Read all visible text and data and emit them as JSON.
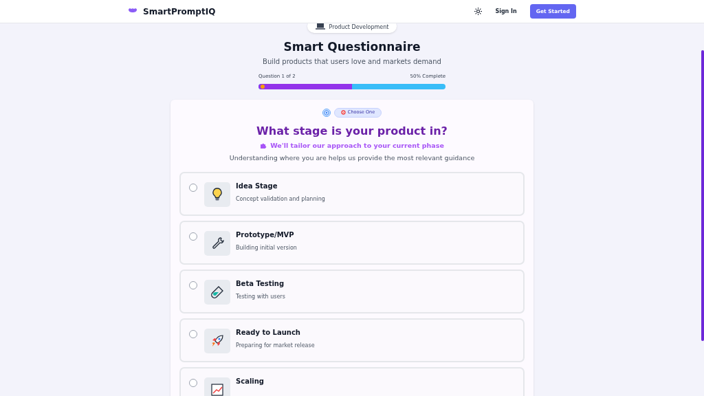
{
  "nav": {
    "brand": "SmartPromptIQ",
    "sign_in": "Sign In",
    "get_started": "Get Started"
  },
  "category": "Product Development",
  "title": "Smart Questionnaire",
  "subtitle": "Build products that users love and markets demand",
  "progress": {
    "label": "Question 1 of 2",
    "reading": "50% Complete",
    "level": 0.5
  },
  "question": {
    "badge": "Choose One",
    "text": "What stage is your product in?",
    "hint": "We'll tailor our approach to your current phase",
    "description": "Understanding where you are helps us provide the most relevant guidance",
    "options": [
      {
        "kind": "bulb",
        "title": "Idea Stage",
        "description": "Concept validation and planning",
        "selected": false
      },
      {
        "kind": "wrench",
        "title": "Prototype/MVP",
        "description": "Building initial version",
        "selected": false
      },
      {
        "kind": "tube",
        "title": "Beta Testing",
        "description": "Testing with users",
        "selected": false
      },
      {
        "kind": "rocket",
        "title": "Ready to Launch",
        "description": "Preparing for market release",
        "selected": false
      },
      {
        "kind": "chart",
        "title": "Scaling",
        "selected": false
      }
    ]
  }
}
